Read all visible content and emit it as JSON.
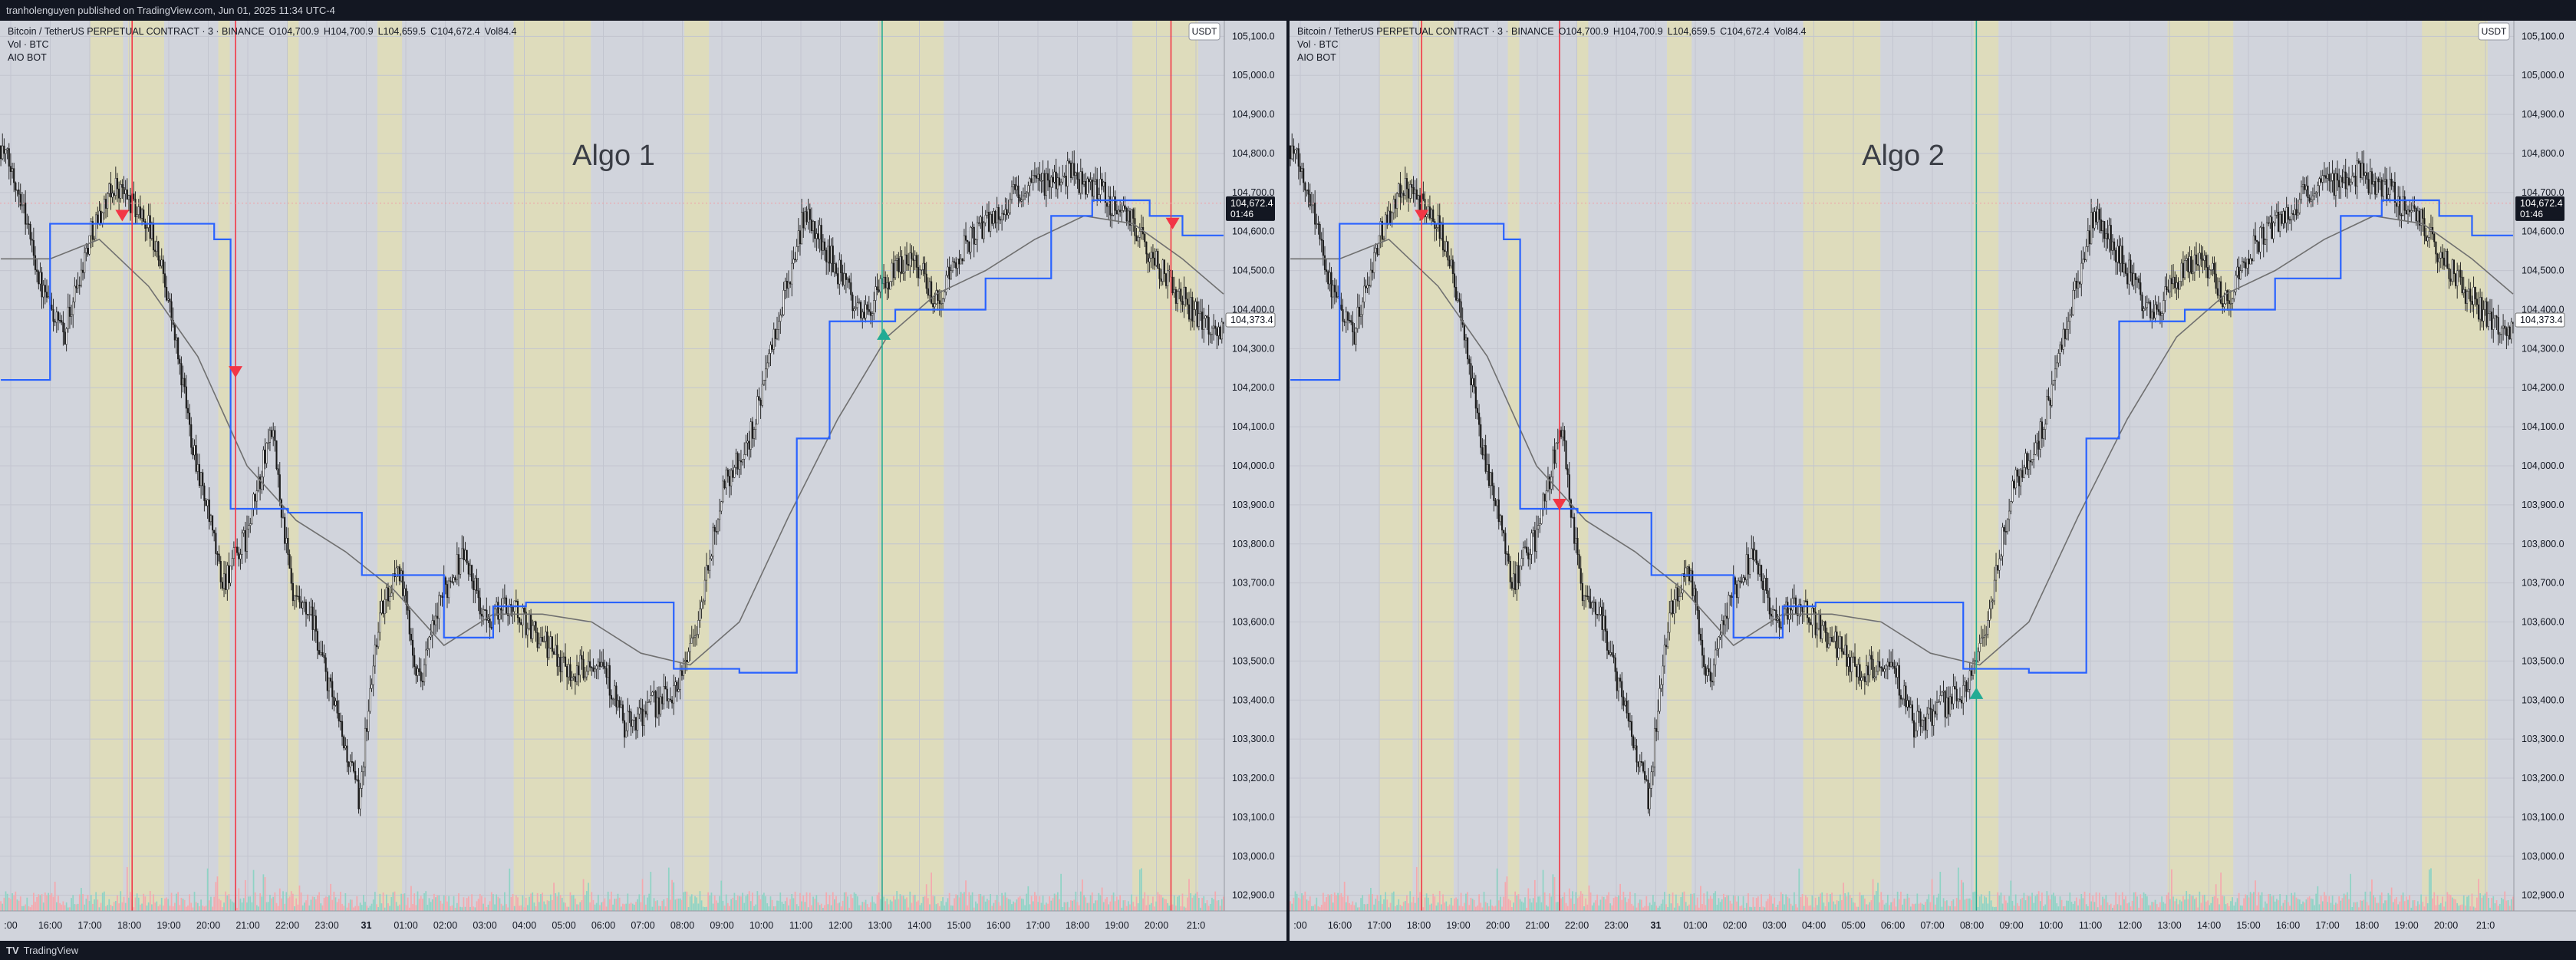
{
  "header": {
    "published": "tranholenguyen published on TradingView.com, Jun 01, 2025 11:34 UTC-4"
  },
  "footer": {
    "brand": "TradingView",
    "logo_icon": "tradingview-logo-icon"
  },
  "symbol": {
    "title": "Bitcoin / TetherUS PERPETUAL CONTRACT · 3 · BINANCE",
    "open": "O104,700.9",
    "high": "H104,700.9",
    "low": "L104,659.5",
    "close": "C104,672.4",
    "vol": "Vol84.4",
    "indicator_vol": "Vol · BTC",
    "indicator_bot": "AIO BOT"
  },
  "currency": "USDT",
  "price_tag": {
    "price": "104,672.4",
    "countdown": "01:46"
  },
  "ma_tag": "104,373.4",
  "colors": {
    "bg": "#d1d4dc",
    "session": "#dedcbc",
    "step_line": "#2962ff",
    "ma_line": "#707070",
    "sell": "#f23645",
    "buy": "#22ab94",
    "volume_up": "#8fd3c5",
    "volume_down": "#f4a9ae"
  },
  "panels": [
    {
      "label": "Algo 1"
    },
    {
      "label": "Algo 2"
    }
  ],
  "chart_data": [
    {
      "type": "candlestick",
      "title": "Algo 1",
      "y_ticks": [
        "105,100.0",
        "105,000.0",
        "104,900.0",
        "104,800.0",
        "104,700.0",
        "104,600.0",
        "104,500.0",
        "104,400.0",
        "104,300.0",
        "104,200.0",
        "104,100.0",
        "104,000.0",
        "103,900.0",
        "103,800.0",
        "103,700.0",
        "103,600.0",
        "103,500.0",
        "103,400.0",
        "103,300.0",
        "103,200.0",
        "103,100.0",
        "103,000.0",
        "102,900.0"
      ],
      "x_ticks": [
        ":00",
        "16:00",
        "17:00",
        "18:00",
        "19:00",
        "20:00",
        "21:00",
        "22:00",
        "23:00",
        "31",
        "01:00",
        "02:00",
        "03:00",
        "04:00",
        "05:00",
        "06:00",
        "07:00",
        "08:00",
        "09:00",
        "10:00",
        "11:00",
        "12:00",
        "13:00",
        "14:00",
        "15:00",
        "16:00",
        "17:00",
        "18:00",
        "19:00",
        "20:00",
        "21:0"
      ],
      "ylim": [
        102860,
        105140
      ],
      "price_keyframes": [
        [
          0,
          104820
        ],
        [
          12,
          104700
        ],
        [
          25,
          104450
        ],
        [
          38,
          104330
        ],
        [
          55,
          104600
        ],
        [
          70,
          104720
        ],
        [
          90,
          104620
        ],
        [
          100,
          104480
        ],
        [
          115,
          104100
        ],
        [
          135,
          103700
        ],
        [
          150,
          103820
        ],
        [
          165,
          104100
        ],
        [
          178,
          103650
        ],
        [
          190,
          103600
        ],
        [
          205,
          103350
        ],
        [
          218,
          103150
        ],
        [
          230,
          103600
        ],
        [
          242,
          103750
        ],
        [
          255,
          103450
        ],
        [
          270,
          103680
        ],
        [
          282,
          103780
        ],
        [
          295,
          103600
        ],
        [
          310,
          103650
        ],
        [
          330,
          103550
        ],
        [
          350,
          103470
        ],
        [
          365,
          103520
        ],
        [
          380,
          103330
        ],
        [
          395,
          103380
        ],
        [
          410,
          103420
        ],
        [
          425,
          103600
        ],
        [
          440,
          103950
        ],
        [
          455,
          104050
        ],
        [
          470,
          104300
        ],
        [
          490,
          104650
        ],
        [
          510,
          104500
        ],
        [
          525,
          104380
        ],
        [
          540,
          104470
        ],
        [
          555,
          104550
        ],
        [
          570,
          104420
        ],
        [
          585,
          104550
        ],
        [
          600,
          104620
        ],
        [
          620,
          104700
        ],
        [
          650,
          104750
        ],
        [
          670,
          104700
        ],
        [
          690,
          104620
        ],
        [
          710,
          104480
        ],
        [
          730,
          104380
        ],
        [
          745,
          104350
        ]
      ],
      "step_line": [
        [
          0,
          104220
        ],
        [
          30,
          104220
        ],
        [
          30,
          104620
        ],
        [
          130,
          104620
        ],
        [
          130,
          104580
        ],
        [
          140,
          104580
        ],
        [
          140,
          103890
        ],
        [
          175,
          103890
        ],
        [
          175,
          103880
        ],
        [
          220,
          103880
        ],
        [
          220,
          103720
        ],
        [
          270,
          103720
        ],
        [
          270,
          103560
        ],
        [
          300,
          103560
        ],
        [
          300,
          103640
        ],
        [
          320,
          103640
        ],
        [
          320,
          103650
        ],
        [
          410,
          103650
        ],
        [
          410,
          103480
        ],
        [
          450,
          103480
        ],
        [
          450,
          103470
        ],
        [
          485,
          103470
        ],
        [
          485,
          104070
        ],
        [
          505,
          104070
        ],
        [
          505,
          104370
        ],
        [
          545,
          104370
        ],
        [
          545,
          104400
        ],
        [
          600,
          104400
        ],
        [
          600,
          104480
        ],
        [
          640,
          104480
        ],
        [
          640,
          104640
        ],
        [
          665,
          104640
        ],
        [
          665,
          104680
        ],
        [
          700,
          104680
        ],
        [
          700,
          104640
        ],
        [
          720,
          104640
        ],
        [
          720,
          104590
        ],
        [
          745,
          104590
        ]
      ],
      "ma_line": [
        [
          0,
          104530
        ],
        [
          30,
          104530
        ],
        [
          60,
          104580
        ],
        [
          90,
          104460
        ],
        [
          120,
          104280
        ],
        [
          150,
          104000
        ],
        [
          180,
          103860
        ],
        [
          210,
          103780
        ],
        [
          240,
          103680
        ],
        [
          270,
          103540
        ],
        [
          300,
          103620
        ],
        [
          330,
          103620
        ],
        [
          360,
          103600
        ],
        [
          390,
          103520
        ],
        [
          420,
          103490
        ],
        [
          450,
          103600
        ],
        [
          480,
          103870
        ],
        [
          510,
          104120
        ],
        [
          540,
          104330
        ],
        [
          570,
          104440
        ],
        [
          600,
          104500
        ],
        [
          630,
          104580
        ],
        [
          660,
          104640
        ],
        [
          690,
          104620
        ],
        [
          720,
          104530
        ],
        [
          745,
          104440
        ]
      ],
      "session_zones": [
        [
          55,
          75
        ],
        [
          78,
          100
        ],
        [
          133,
          140
        ],
        [
          175,
          182
        ],
        [
          230,
          245
        ],
        [
          313,
          360
        ],
        [
          417,
          432
        ],
        [
          535,
          575
        ],
        [
          690,
          730
        ]
      ],
      "vertical_lines": [
        {
          "x": 80,
          "type": "sell"
        },
        {
          "x": 143,
          "type": "sell"
        },
        {
          "x": 537,
          "type": "buy"
        },
        {
          "x": 713,
          "type": "sell"
        }
      ],
      "signals": [
        {
          "x": 74,
          "y": 104620,
          "type": "sell"
        },
        {
          "x": 143,
          "y": 104220,
          "type": "sell"
        },
        {
          "x": 538,
          "y": 104360,
          "type": "buy"
        },
        {
          "x": 714,
          "y": 104600,
          "type": "sell"
        }
      ]
    },
    {
      "type": "candlestick",
      "title": "Algo 2",
      "y_ticks": [
        "105,100.0",
        "105,000.0",
        "104,900.0",
        "104,800.0",
        "104,700.0",
        "104,600.0",
        "104,500.0",
        "104,400.0",
        "104,300.0",
        "104,200.0",
        "104,100.0",
        "104,000.0",
        "103,900.0",
        "103,800.0",
        "103,700.0",
        "103,600.0",
        "103,500.0",
        "103,400.0",
        "103,300.0",
        "103,200.0",
        "103,100.0",
        "103,000.0",
        "102,900.0"
      ],
      "x_ticks": [
        ":00",
        "16:00",
        "17:00",
        "18:00",
        "19:00",
        "20:00",
        "21:00",
        "22:00",
        "23:00",
        "31",
        "01:00",
        "02:00",
        "03:00",
        "04:00",
        "05:00",
        "06:00",
        "07:00",
        "08:00",
        "09:00",
        "10:00",
        "11:00",
        "12:00",
        "13:00",
        "14:00",
        "15:00",
        "16:00",
        "17:00",
        "18:00",
        "19:00",
        "20:00",
        "21:0"
      ],
      "ylim": [
        102860,
        105140
      ],
      "price_keyframes": [
        [
          0,
          104820
        ],
        [
          12,
          104700
        ],
        [
          25,
          104450
        ],
        [
          38,
          104330
        ],
        [
          55,
          104600
        ],
        [
          70,
          104720
        ],
        [
          90,
          104620
        ],
        [
          100,
          104480
        ],
        [
          115,
          104100
        ],
        [
          135,
          103700
        ],
        [
          150,
          103820
        ],
        [
          165,
          104100
        ],
        [
          178,
          103650
        ],
        [
          190,
          103600
        ],
        [
          205,
          103350
        ],
        [
          218,
          103150
        ],
        [
          230,
          103600
        ],
        [
          242,
          103750
        ],
        [
          255,
          103450
        ],
        [
          270,
          103680
        ],
        [
          282,
          103780
        ],
        [
          295,
          103600
        ],
        [
          310,
          103650
        ],
        [
          330,
          103550
        ],
        [
          350,
          103470
        ],
        [
          365,
          103520
        ],
        [
          380,
          103330
        ],
        [
          395,
          103380
        ],
        [
          410,
          103420
        ],
        [
          425,
          103600
        ],
        [
          440,
          103950
        ],
        [
          455,
          104050
        ],
        [
          470,
          104300
        ],
        [
          490,
          104650
        ],
        [
          510,
          104500
        ],
        [
          525,
          104380
        ],
        [
          540,
          104470
        ],
        [
          555,
          104550
        ],
        [
          570,
          104420
        ],
        [
          585,
          104550
        ],
        [
          600,
          104620
        ],
        [
          620,
          104700
        ],
        [
          650,
          104750
        ],
        [
          670,
          104700
        ],
        [
          690,
          104620
        ],
        [
          710,
          104480
        ],
        [
          730,
          104380
        ],
        [
          745,
          104350
        ]
      ],
      "step_line": [
        [
          0,
          104220
        ],
        [
          30,
          104220
        ],
        [
          30,
          104620
        ],
        [
          130,
          104620
        ],
        [
          130,
          104580
        ],
        [
          140,
          104580
        ],
        [
          140,
          103890
        ],
        [
          175,
          103890
        ],
        [
          175,
          103880
        ],
        [
          220,
          103880
        ],
        [
          220,
          103720
        ],
        [
          270,
          103720
        ],
        [
          270,
          103560
        ],
        [
          300,
          103560
        ],
        [
          300,
          103640
        ],
        [
          320,
          103640
        ],
        [
          320,
          103650
        ],
        [
          410,
          103650
        ],
        [
          410,
          103480
        ],
        [
          450,
          103480
        ],
        [
          450,
          103470
        ],
        [
          485,
          103470
        ],
        [
          485,
          104070
        ],
        [
          505,
          104070
        ],
        [
          505,
          104370
        ],
        [
          545,
          104370
        ],
        [
          545,
          104400
        ],
        [
          600,
          104400
        ],
        [
          600,
          104480
        ],
        [
          640,
          104480
        ],
        [
          640,
          104640
        ],
        [
          665,
          104640
        ],
        [
          665,
          104680
        ],
        [
          700,
          104680
        ],
        [
          700,
          104640
        ],
        [
          720,
          104640
        ],
        [
          720,
          104590
        ],
        [
          745,
          104590
        ]
      ],
      "ma_line": [
        [
          0,
          104530
        ],
        [
          30,
          104530
        ],
        [
          60,
          104580
        ],
        [
          90,
          104460
        ],
        [
          120,
          104280
        ],
        [
          150,
          104000
        ],
        [
          180,
          103860
        ],
        [
          210,
          103780
        ],
        [
          240,
          103680
        ],
        [
          270,
          103540
        ],
        [
          300,
          103620
        ],
        [
          330,
          103620
        ],
        [
          360,
          103600
        ],
        [
          390,
          103520
        ],
        [
          420,
          103490
        ],
        [
          450,
          103600
        ],
        [
          480,
          103870
        ],
        [
          510,
          104120
        ],
        [
          540,
          104330
        ],
        [
          570,
          104440
        ],
        [
          600,
          104500
        ],
        [
          630,
          104580
        ],
        [
          660,
          104640
        ],
        [
          690,
          104620
        ],
        [
          720,
          104530
        ],
        [
          745,
          104440
        ]
      ],
      "session_zones": [
        [
          55,
          75
        ],
        [
          78,
          100
        ],
        [
          133,
          140
        ],
        [
          175,
          182
        ],
        [
          230,
          245
        ],
        [
          313,
          360
        ],
        [
          417,
          432
        ],
        [
          535,
          575
        ],
        [
          690,
          730
        ]
      ],
      "vertical_lines": [
        {
          "x": 80,
          "type": "sell"
        },
        {
          "x": 164,
          "type": "sell"
        },
        {
          "x": 418,
          "type": "buy"
        }
      ],
      "signals": [
        {
          "x": 80,
          "y": 104620,
          "type": "sell"
        },
        {
          "x": 164,
          "y": 103880,
          "type": "sell"
        },
        {
          "x": 418,
          "y": 103440,
          "type": "buy"
        }
      ]
    }
  ]
}
